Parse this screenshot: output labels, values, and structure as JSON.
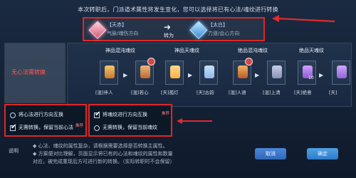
{
  "header": {
    "text": "本次转职后，门派道术属性将发生变化，您可以选择将已有心法/魂纹进行转换"
  },
  "top_conversion": {
    "from_title": "【天赤】",
    "from_desc": "气脉/魂伤方向",
    "convert_label": "转为",
    "to_title": "【太白】",
    "to_desc": "力道/会心方向"
  },
  "left_panel": {
    "label": "无心法需转换"
  },
  "columns": [
    {
      "title": "神品混沌魂纹"
    },
    {
      "title": "神品天魂纹"
    },
    {
      "title": "绝品混沌魂纹"
    },
    {
      "title": "绝品天魂纹"
    }
  ],
  "items": [
    {
      "caption": "[混]伴人",
      "badge": ""
    },
    {
      "caption": "[混]若心",
      "badge": ""
    },
    {
      "caption": "[天]孤灯",
      "badge": ""
    },
    {
      "caption": "[天]古韵",
      "badge": ""
    },
    {
      "caption": "[混]人语",
      "badge": ""
    },
    {
      "caption": "[混]上清",
      "badge": ""
    },
    {
      "caption": "[天]绝意",
      "badge": "10"
    },
    {
      "caption": "[天]",
      "badge": ""
    }
  ],
  "options": {
    "left": [
      {
        "label": "将心法进行方向互换",
        "checked": false
      },
      {
        "label": "无需转换，保留当前心法",
        "checked": true,
        "tag": "推荐"
      }
    ],
    "right": [
      {
        "label": "将魂纹进行方向互换",
        "checked": true,
        "tag": "推荐"
      },
      {
        "label": "无需转换，保留当前魂纹",
        "checked": false
      }
    ]
  },
  "notes": {
    "label": "说明",
    "line1": "◆ 心法、魂纹的属性复杂，请根据需要选择是否转换主属性。",
    "line2": "◆ 方案便对比理解，页面显示将已有的心法和魂纹的属性和数量",
    "line3": "对应，被完成重现后方可进行新的转换。（实际转职时不会保留）"
  },
  "buttons": {
    "cancel": "取消",
    "confirm": "确定"
  }
}
